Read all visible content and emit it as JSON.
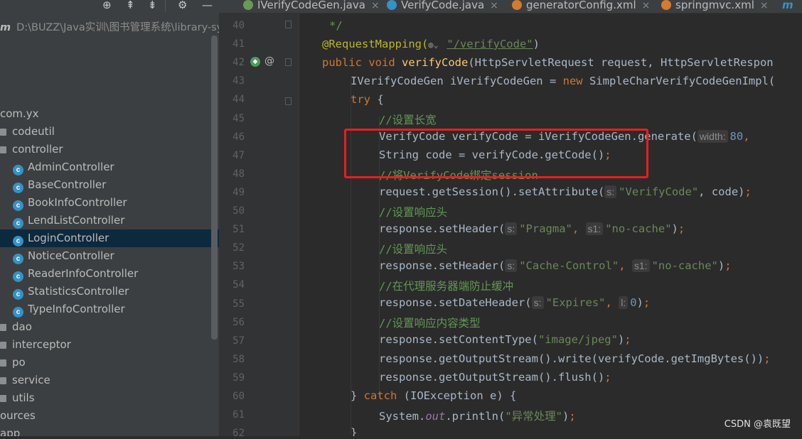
{
  "sidebar": {
    "path_prefix": "m",
    "path": "D:\\BUZZ\\Java实训\\图书管理系统\\library-sy",
    "tree": [
      {
        "label": "com.yx",
        "kind": "package"
      },
      {
        "label": "codeutil",
        "kind": "folder"
      },
      {
        "label": "controller",
        "kind": "folder"
      },
      {
        "label": "AdminController",
        "kind": "class"
      },
      {
        "label": "BaseController",
        "kind": "class"
      },
      {
        "label": "BookInfoController",
        "kind": "class"
      },
      {
        "label": "LendListController",
        "kind": "class"
      },
      {
        "label": "LoginController",
        "kind": "class",
        "selected": true
      },
      {
        "label": "NoticeController",
        "kind": "class"
      },
      {
        "label": "ReaderInfoController",
        "kind": "class"
      },
      {
        "label": "StatisticsController",
        "kind": "class"
      },
      {
        "label": "TypeInfoController",
        "kind": "class"
      },
      {
        "label": "dao",
        "kind": "folder"
      },
      {
        "label": "interceptor",
        "kind": "folder"
      },
      {
        "label": "po",
        "kind": "folder"
      },
      {
        "label": "service",
        "kind": "folder"
      },
      {
        "label": "utils",
        "kind": "folder"
      },
      {
        "label": "ources",
        "kind": "text"
      },
      {
        "label": "app",
        "kind": "text"
      }
    ]
  },
  "tabs": [
    {
      "label": "IVerifyCodeGen.java",
      "icon": "interface-icon",
      "color": "#6a9955"
    },
    {
      "label": "VerifyCode.java",
      "icon": "class-icon",
      "color": "#3592c4"
    },
    {
      "label": "generatorConfig.xml",
      "icon": "xml-icon",
      "color": "#d47b2e"
    },
    {
      "label": "springmvc.xml",
      "icon": "xml-icon",
      "color": "#d47b2e"
    }
  ],
  "editor": {
    "line_numbers": [
      "40",
      "41",
      "42",
      "43",
      "44",
      "45",
      "46",
      "47",
      "48",
      "49",
      "50",
      "51",
      "52",
      "53",
      "54",
      "55",
      "56",
      "57",
      "58",
      "59",
      "60",
      "61",
      "62"
    ],
    "l40": "*/",
    "l41_ann": "@RequestMapping(",
    "l41_path": "\"/verifyCode\"",
    "l41_close": ")",
    "l42_kw1": "public",
    "l42_kw2": "void",
    "l42_fn": "verifyCode",
    "l42_rest": "(HttpServletRequest request, HttpServletRespon",
    "l43_a": "IVerifyCodeGen iVerifyCodeGen = ",
    "l43_kw": "new",
    "l43_b": " SimpleCharVerifyCodeGenImpl(",
    "l44_kw": "try",
    "l44_rest": " {",
    "l45": "//设置长宽",
    "l46_a": "VerifyCode verifyCode = iVerifyCodeGen.generate(",
    "l46_hint": "width:",
    "l46_num": "80",
    "l46_b": ",",
    "l47_a": "String code = verifyCode.getCode()",
    "l47_semi": ";",
    "l48": "//将VerifyCode绑定session",
    "l49_a": "request.getSession().setAttribute(",
    "l49_hint": "s:",
    "l49_str": "\"VerifyCode\"",
    "l49_b": ", code)",
    "l50": "//设置响应头",
    "l51_a": "response.setHeader(",
    "l51_hint1": "s:",
    "l51_str1": "\"Pragma\"",
    "l51_hint2": "s1:",
    "l51_str2": "\"no-cache\"",
    "l52": "//设置响应头",
    "l53_a": "response.setHeader(",
    "l53_hint1": "s:",
    "l53_str1": "\"Cache-Control\"",
    "l53_hint2": "s1:",
    "l53_str2": "\"no-cache\"",
    "l54": "//在代理服务器端防止缓冲",
    "l55_a": "response.setDateHeader(",
    "l55_hint1": "s:",
    "l55_str1": "\"Expires\"",
    "l55_hint2": "l:",
    "l55_num": "0",
    "l56": "//设置响应内容类型",
    "l57_a": "response.setContentType(",
    "l57_str": "\"image/jpeg\"",
    "l58": "response.getOutputStream().write(verifyCode.getImgBytes())",
    "l59": "response.getOutputStream().flush()",
    "l60_a": "} ",
    "l60_kw": "catch",
    "l60_b": " (IOException e) {",
    "l61_a": "System.",
    "l61_fld": "out",
    "l61_b": ".println(",
    "l61_str": "\"异常处理\"",
    "l62": "}"
  },
  "watermark": "CSDN @袁既望",
  "colors": {
    "highlight_box": "#e81e1e",
    "selected_row": "#0d293e"
  }
}
